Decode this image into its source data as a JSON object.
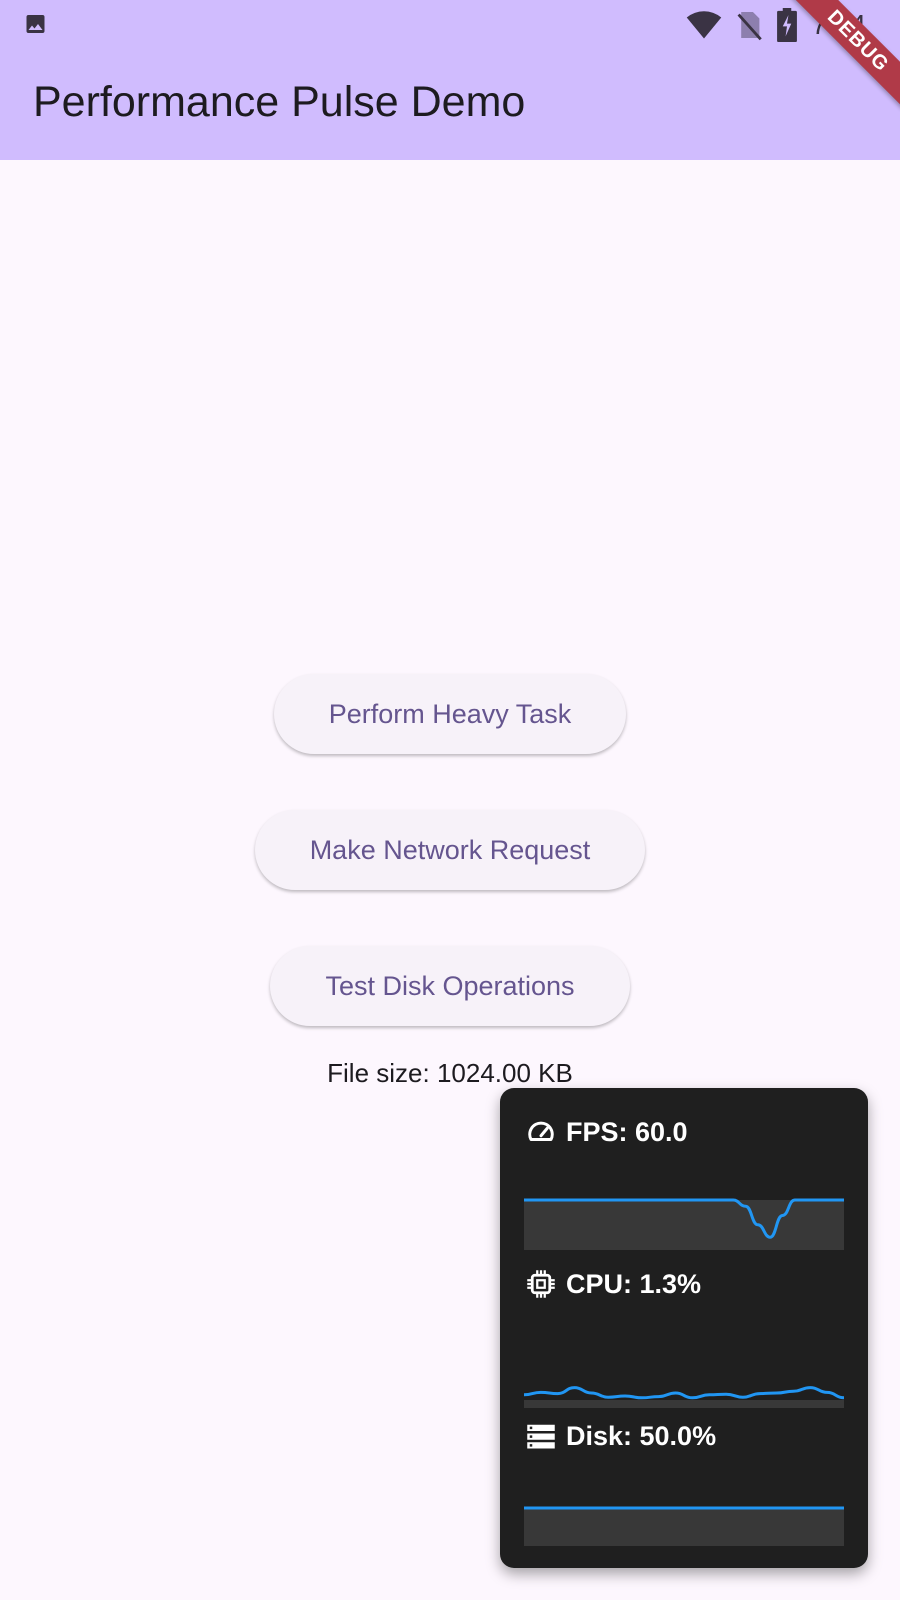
{
  "status_bar": {
    "time": "7:04",
    "icons": [
      "image-icon",
      "wifi-icon",
      "no-sim-icon",
      "battery-charging-icon"
    ]
  },
  "app_bar": {
    "title": "Performance Pulse Demo",
    "debug_banner": "DEBUG",
    "color": "#d0bcfe"
  },
  "actions": {
    "heavy_task_label": "Perform Heavy Task",
    "network_request_label": "Make Network Request",
    "disk_ops_label": "Test Disk Operations"
  },
  "file_size_text": "File size: 1024.00 KB",
  "monitor": {
    "fps_label": "FPS: 60.0",
    "cpu_label": "CPU: 1.3%",
    "disk_label": "Disk: 50.0%",
    "line_color": "#2196f3",
    "fps_series": [
      60,
      60,
      60,
      60,
      60,
      60,
      60,
      60,
      60,
      60,
      60,
      60,
      60,
      60,
      60,
      60,
      60,
      60,
      58,
      52,
      48,
      55,
      60,
      60,
      60,
      60,
      60
    ],
    "cpu_series": [
      1.2,
      1.6,
      1.4,
      2.4,
      1.5,
      0.8,
      1.0,
      0.7,
      0.9,
      1.5,
      0.7,
      1.2,
      1.3,
      0.8,
      1.4,
      1.5,
      1.8,
      2.4,
      1.6,
      0.7
    ],
    "disk_series": [
      50,
      50,
      50,
      50,
      50,
      50
    ]
  }
}
